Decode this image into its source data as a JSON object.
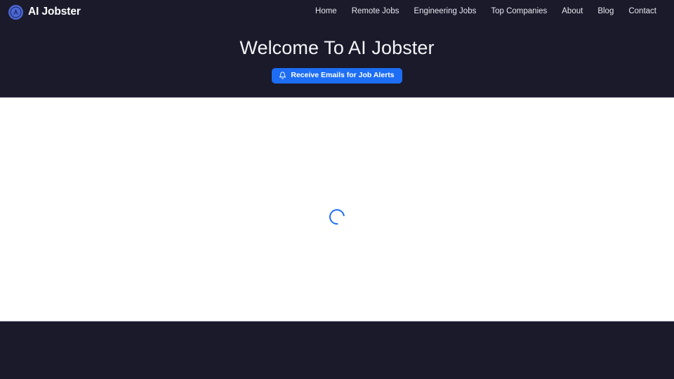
{
  "header": {
    "brand": {
      "icon": "ai-jobster-logo-icon",
      "name": "AI Jobster"
    },
    "nav": [
      {
        "label": "Home"
      },
      {
        "label": "Remote Jobs"
      },
      {
        "label": "Engineering Jobs"
      },
      {
        "label": "Top Companies"
      },
      {
        "label": "About"
      },
      {
        "label": "Blog"
      },
      {
        "label": "Contact"
      }
    ]
  },
  "hero": {
    "title": "Welcome To AI Jobster",
    "cta": {
      "icon": "bell-icon",
      "label": "Receive Emails for Job Alerts"
    }
  },
  "main": {
    "loading": {
      "icon": "spinner-icon",
      "status_text": "Loading"
    }
  },
  "footer": {},
  "colors": {
    "dark_background": "#1a1a2b",
    "accent_blue": "#1d6ef5",
    "brand_mark_blue": "#4d68d4",
    "page_background": "#ffffff",
    "divider": "#c9cad4"
  }
}
